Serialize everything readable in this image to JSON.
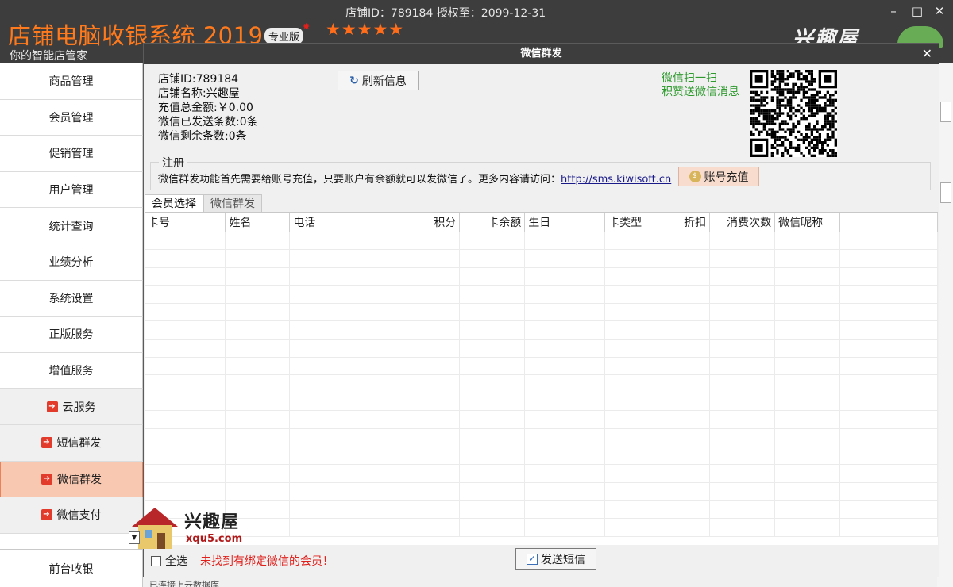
{
  "window": {
    "app_title": "店铺电脑收银系统 2019",
    "edition": "专业版",
    "stars": "★★★★★",
    "slogan": "你的智能店管家",
    "shop_info": "店铺ID：789184 授权至：2099-12-31",
    "brand": "兴趣屋",
    "minimize": "–",
    "maximize": "□",
    "close": "✕"
  },
  "sidebar": {
    "items": [
      {
        "label": "商品管理"
      },
      {
        "label": "会员管理"
      },
      {
        "label": "促销管理"
      },
      {
        "label": "用户管理"
      },
      {
        "label": "统计查询"
      },
      {
        "label": "业绩分析"
      },
      {
        "label": "系统设置"
      },
      {
        "label": "正版服务"
      },
      {
        "label": "增值服务"
      }
    ],
    "sub_items": [
      {
        "label": "云服务"
      },
      {
        "label": "短信群发"
      },
      {
        "label": "微信群发"
      },
      {
        "label": "微信支付"
      }
    ],
    "bottom": "前台收银"
  },
  "dialog": {
    "title": "微信群发",
    "close": "✕",
    "info": {
      "shop_id": "店铺ID:789184",
      "shop_name": "店铺名称:兴趣屋",
      "recharge_total": "充值总金额:￥0.00",
      "sent_count": "微信已发送条数:0条",
      "remaining_count": "微信剩余条数:0条"
    },
    "refresh_button": "刷新信息",
    "qr_text_line1": "微信扫一扫",
    "qr_text_line2": "积赞送微信消息",
    "register": {
      "legend": "注册",
      "text": "微信群发功能首先需要给账号充值，只要账户有余额就可以发微信了。更多内容请访问：",
      "link": "http://sms.kiwisoft.cn",
      "recharge_button": "账号充值"
    },
    "tabs": [
      {
        "label": "会员选择"
      },
      {
        "label": "微信群发"
      }
    ],
    "table": {
      "columns": [
        "卡号",
        "姓名",
        "电话",
        "积分",
        "卡余额",
        "生日",
        "卡类型",
        "折扣",
        "消费次数",
        "微信昵称"
      ]
    },
    "footer": {
      "select_all": "全选",
      "warning": "未找到有绑定微信的会员！",
      "send_button": "发送短信"
    }
  },
  "watermark": {
    "name": "兴趣屋",
    "url": "xqu5.com"
  },
  "status_text": "已连接上云数据库",
  "colors": {
    "title_orange": "#ff7a1c",
    "active_nav": "#f9c8b1",
    "warning_red": "#e0201b",
    "qr_green": "#2e9a2e"
  }
}
